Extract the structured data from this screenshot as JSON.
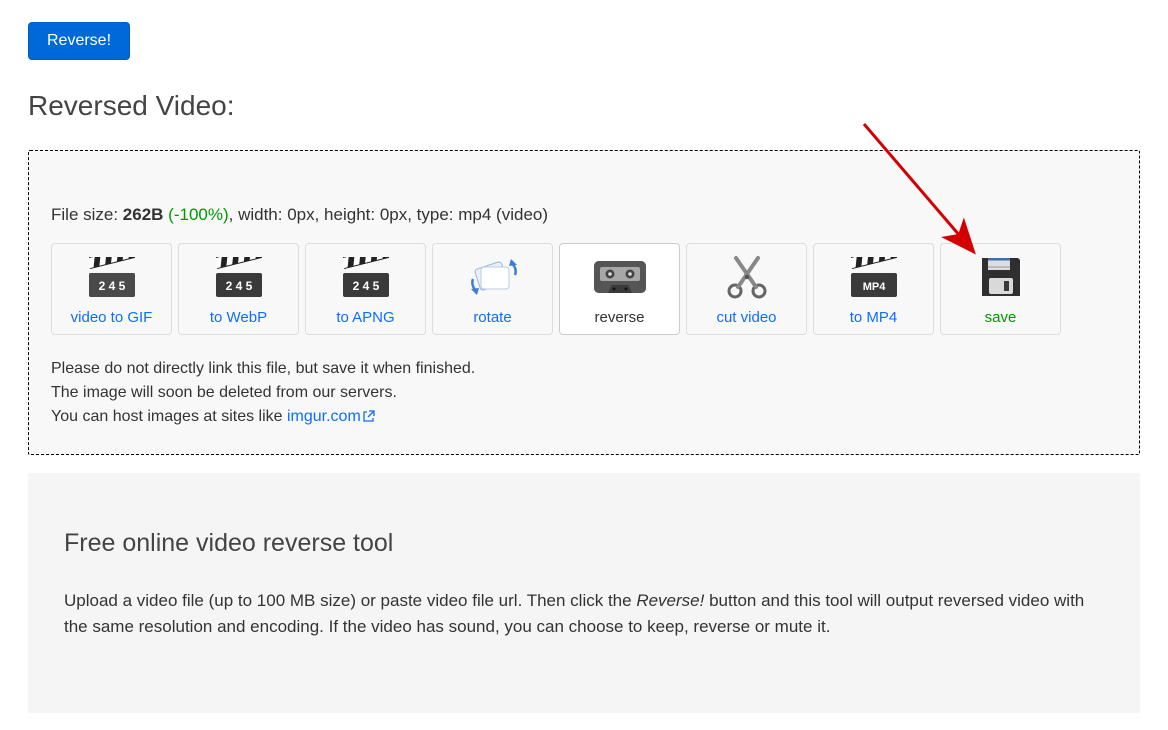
{
  "reverse_button_label": "Reverse!",
  "section_title": "Reversed Video:",
  "fileinfo": {
    "prefix": "File size: ",
    "size": "262B",
    "pct": " (-100%)",
    "rest": ", width: 0px, height: 0px, type: mp4 (video)"
  },
  "tiles": [
    {
      "label": "video to GIF"
    },
    {
      "label": "to WebP"
    },
    {
      "label": "to APNG"
    },
    {
      "label": "rotate"
    },
    {
      "label": "reverse"
    },
    {
      "label": "cut video"
    },
    {
      "label": "to MP4"
    },
    {
      "label": "save"
    }
  ],
  "notes": {
    "l1": "Please do not directly link this file, but save it when finished.",
    "l2": "The image will soon be deleted from our servers.",
    "l3a": "You can host images at sites like ",
    "l3_link": "imgur.com"
  },
  "info": {
    "heading": "Free online video reverse tool",
    "para_a": "Upload a video file (up to 100 MB size) or paste video file url. Then click the ",
    "para_em": "Reverse!",
    "para_b": " button and this tool will output reversed video with the same resolution and encoding. If the video has sound, you can choose to keep, reverse or mute it."
  }
}
